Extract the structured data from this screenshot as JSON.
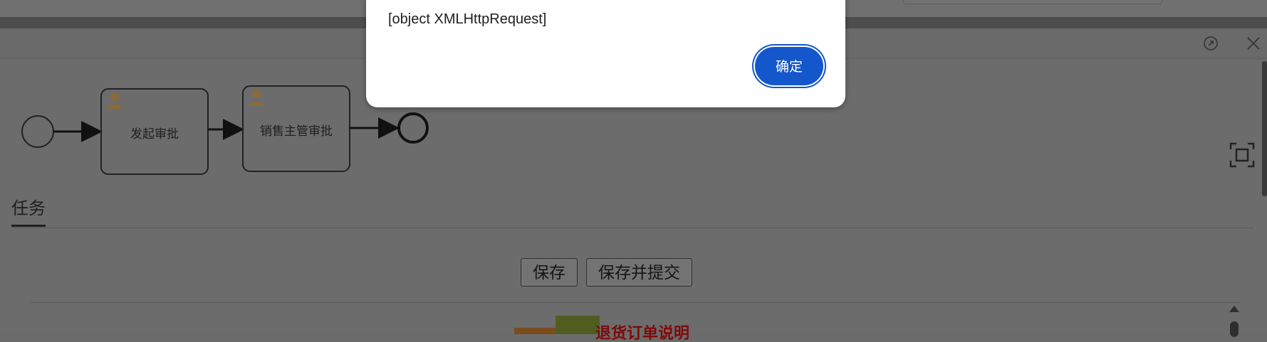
{
  "dialog": {
    "message": "[object XMLHttpRequest]",
    "ok_label": "确定",
    "accent_color": "#1456cc"
  },
  "diagram": {
    "tasks": [
      {
        "label": "发起审批",
        "icon": "user-icon"
      },
      {
        "label": "销售主管审批",
        "icon": "user-icon"
      }
    ]
  },
  "tabs": [
    {
      "label": "任务",
      "active": true
    }
  ],
  "toolbar": {
    "save_label": "保存",
    "save_submit_label": "保存并提交"
  },
  "form": {
    "section_title": "退货订单说明",
    "title_color": "#7e0a0a"
  },
  "window": {
    "restore_icon": "restore-icon",
    "close_icon": "close-icon"
  }
}
